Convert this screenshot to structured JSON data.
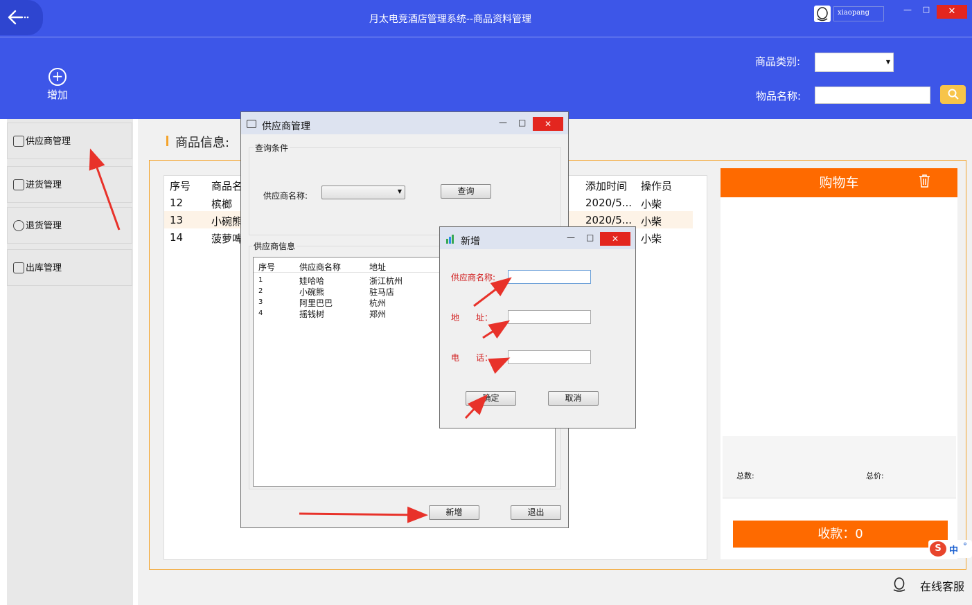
{
  "app": {
    "title": "月太电竞酒店管理系统--商品资料管理",
    "username": "xiaopang"
  },
  "window": {
    "minimize_glyph": "—",
    "maximize_glyph": "□",
    "close_glyph": "✕"
  },
  "toolbar": {
    "add_label": "增加",
    "category_label": "商品类别:",
    "category_value": "",
    "name_label": "物品名称:",
    "name_value": ""
  },
  "sidebar": {
    "items": [
      {
        "label": "供应商管理",
        "icon": "store-icon"
      },
      {
        "label": "进货管理",
        "icon": "clipboard-icon"
      },
      {
        "label": "退货管理",
        "icon": "return-icon"
      },
      {
        "label": "出库管理",
        "icon": "outbox-icon"
      }
    ]
  },
  "goods": {
    "title": "商品信息:",
    "columns": [
      "序号",
      "商品名",
      "添加时间",
      "操作员"
    ],
    "rows": [
      {
        "id": "12",
        "name": "槟榔",
        "time": "2020/5...",
        "operator": "小柴"
      },
      {
        "id": "13",
        "name": "小碗熊",
        "time": "2020/5...",
        "operator": "小柴"
      },
      {
        "id": "14",
        "name": "菠萝啤",
        "time": "",
        "operator": "小柴"
      }
    ]
  },
  "cart": {
    "title": "购物车",
    "count_label": "总数:",
    "price_label": "总价:",
    "pay_label": "收款：0"
  },
  "ime": {
    "s": "S",
    "lang": "中",
    "dot": "°"
  },
  "service": {
    "label": "在线客服"
  },
  "supplier_dialog": {
    "title": "供应商管理",
    "query_group": "查询条件",
    "supplier_name_label": "供应商名称:",
    "supplier_name_value": "",
    "query_button": "查询",
    "info_group": "供应商信息",
    "columns": [
      "序号",
      "供应商名称",
      "地址"
    ],
    "rows": [
      {
        "id": "1",
        "name": "娃哈哈",
        "addr": "浙江杭州"
      },
      {
        "id": "2",
        "name": "小碗熊",
        "addr": "驻马店"
      },
      {
        "id": "3",
        "name": "阿里巴巴",
        "addr": "杭州"
      },
      {
        "id": "4",
        "name": "摇钱树",
        "addr": "郑州"
      }
    ],
    "new_button": "新增",
    "exit_button": "退出"
  },
  "new_dialog": {
    "title": "新增",
    "name_label": "供应商名称:",
    "address_label": "地　　址：",
    "phone_label": "电　　话：",
    "confirm_button": "确定",
    "cancel_button": "取消"
  },
  "colors": {
    "header_blue": "#3d56e8",
    "accent_orange": "#fe6a00",
    "close_red": "#e3261f",
    "annotation_red": "#e8322a"
  }
}
